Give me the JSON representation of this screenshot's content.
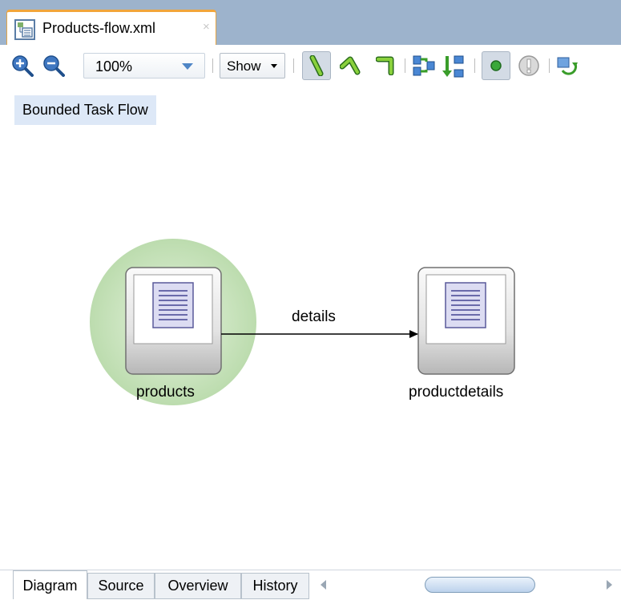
{
  "editor_tab": {
    "file_name": "Products-flow.xml",
    "close_glyph": "×",
    "icon": "xml-file-icon"
  },
  "toolbar": {
    "zoom_in_icon": "zoom-in-icon",
    "zoom_out_icon": "zoom-out-icon",
    "zoom_value": "100%",
    "show_label": "Show",
    "buttons": [
      "straight-line-icon",
      "elbow-line-icon",
      "orthogonal-line-icon",
      "layout-horizontal-icon",
      "layout-vertical-icon",
      "activity-point-icon",
      "warning-icon",
      "refresh-icon"
    ]
  },
  "canvas": {
    "badge": "Bounded Task Flow",
    "nodes": [
      {
        "name": "products",
        "default_activity": true,
        "icon": "view-activity-icon"
      },
      {
        "name": "productdetails",
        "default_activity": false,
        "icon": "view-activity-icon"
      }
    ],
    "edge": {
      "from": "products",
      "to": "productdetails",
      "label": "details"
    }
  },
  "bottom_tabs": {
    "items": [
      "Diagram",
      "Source",
      "Overview",
      "History"
    ],
    "active": "Diagram"
  },
  "colors": {
    "tab_strip": "#9db3cc",
    "active_tab_accent": "#f2a53a",
    "badge_bg": "#dde8f7",
    "default_activity_halo": "#d6ebcd"
  }
}
